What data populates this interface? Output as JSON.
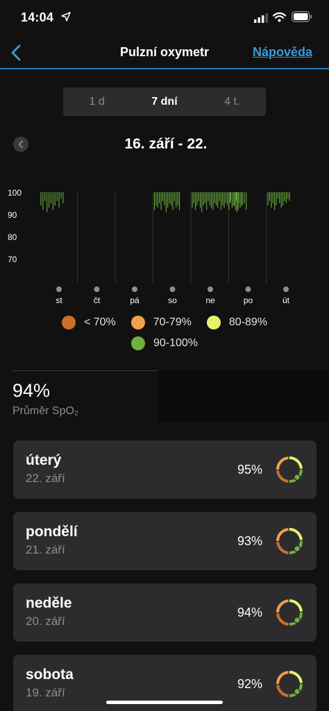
{
  "status_bar": {
    "time": "14:04"
  },
  "nav": {
    "back_icon": "chevron-left-icon",
    "title": "Pulzní oxymetr",
    "help": "Nápověda"
  },
  "range_tabs": [
    {
      "label": "1 d",
      "active": false
    },
    {
      "label": "7 dní",
      "active": true
    },
    {
      "label": "4 t.",
      "active": false
    }
  ],
  "period": {
    "prev_icon": "chevron-left-icon",
    "label": "16. září - 22."
  },
  "colors": {
    "accent": "#3a9ad9",
    "below_70": "#c8702b",
    "range_70_79": "#f0a14a",
    "range_80_89": "#e6f26a",
    "range_90_100": "#6db33f"
  },
  "chart_data": {
    "type": "bar",
    "yticks": [
      "100",
      "90",
      "80",
      "70"
    ],
    "ylim": [
      60,
      100
    ],
    "categories": [
      "st",
      "čt",
      "pá",
      "so",
      "ne",
      "po",
      "út"
    ],
    "legend": [
      "< 70%",
      "70-79%",
      "80-89%",
      "90-100%"
    ],
    "series": [
      {
        "values": [
          {
            "day": "st",
            "readings": [
              94,
              92,
              96,
              91,
              93,
              95,
              92,
              94,
              96,
              93,
              97,
              95
            ]
          },
          {
            "day": "čt",
            "readings": []
          },
          {
            "day": "pá",
            "readings": []
          },
          {
            "day": "so",
            "readings": [
              92,
              94,
              93,
              95,
              92,
              96,
              94,
              91,
              93,
              95,
              94,
              92,
              96,
              93,
              94,
              92
            ]
          },
          {
            "day": "ne",
            "readings": [
              93,
              95,
              92,
              94,
              96,
              93,
              91,
              94,
              95,
              92,
              96,
              94,
              93,
              92,
              95,
              94,
              93,
              96,
              92,
              94,
              93,
              95,
              94,
              92,
              96,
              93,
              94,
              92,
              91,
              95,
              93,
              94
            ]
          },
          {
            "day": "po",
            "readings": [
              95,
              93,
              94,
              96,
              92,
              93,
              94,
              95,
              92
            ]
          },
          {
            "day": "út",
            "readings": [
              94,
              96,
              93,
              95,
              92,
              94,
              97,
              95,
              93,
              94,
              96,
              95,
              97,
              96
            ]
          }
        ]
      }
    ]
  },
  "average": {
    "value": "94%",
    "label": "Průměr SpO₂"
  },
  "days": [
    {
      "name": "úterý",
      "date": "22. září",
      "value": "95%"
    },
    {
      "name": "pondělí",
      "date": "21. září",
      "value": "93%"
    },
    {
      "name": "neděle",
      "date": "20. září",
      "value": "94%"
    },
    {
      "name": "sobota",
      "date": "19. září",
      "value": "92%"
    }
  ]
}
